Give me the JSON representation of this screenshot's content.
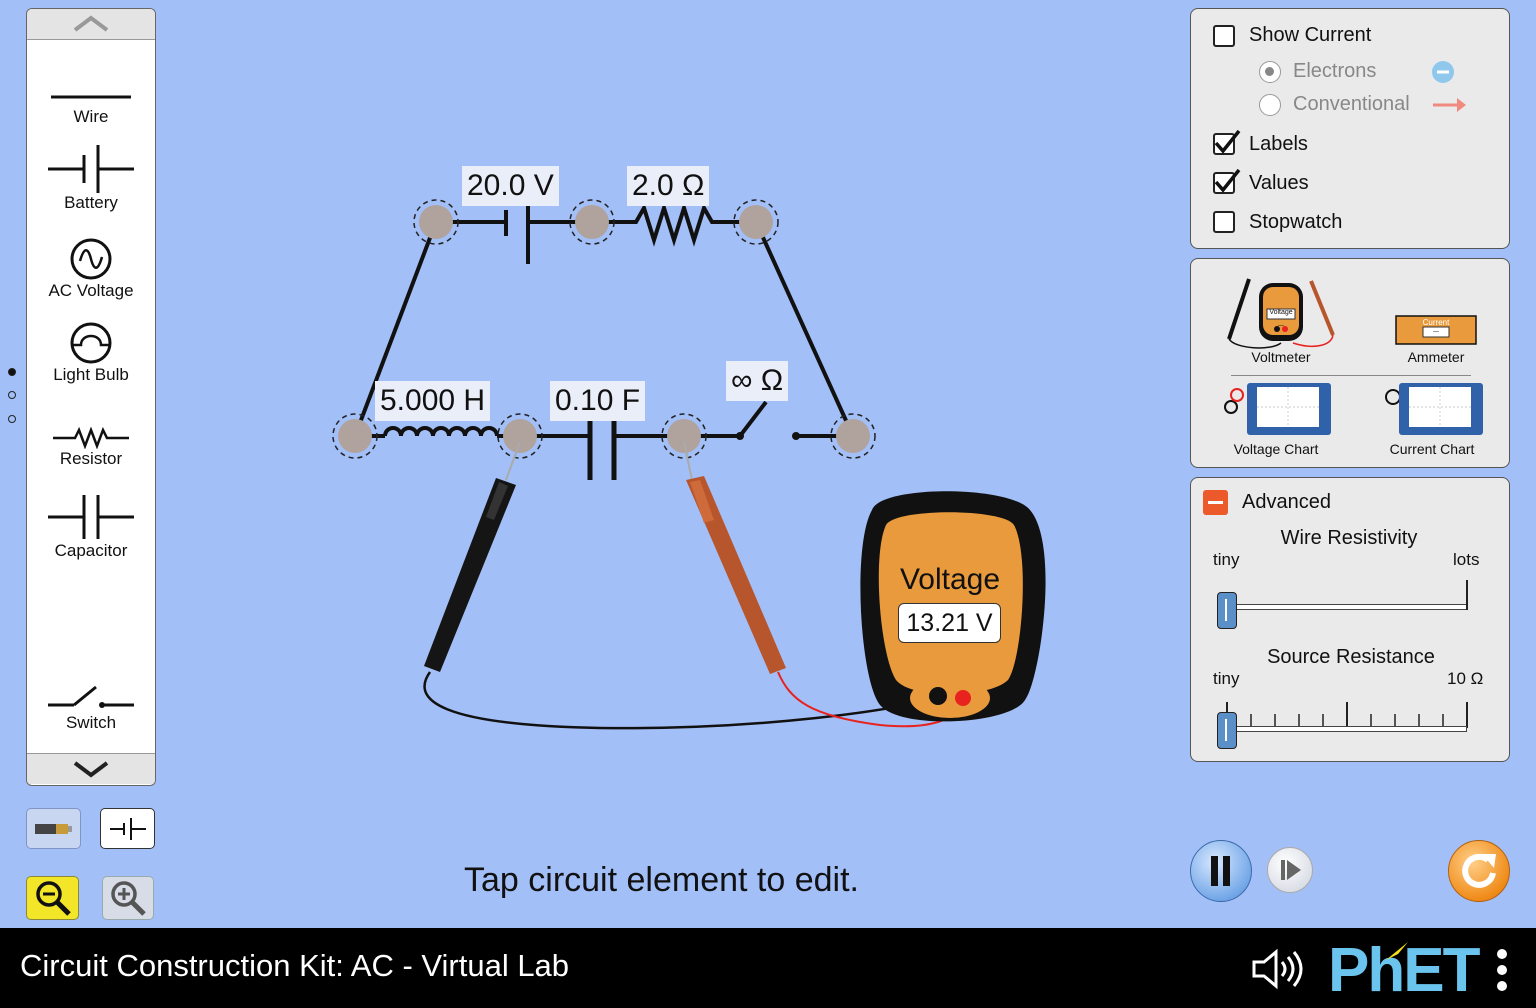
{
  "toolbox": {
    "items": [
      {
        "label": "Wire"
      },
      {
        "label": "Battery"
      },
      {
        "label": "AC Voltage"
      },
      {
        "label": "Light Bulb"
      },
      {
        "label": "Resistor"
      },
      {
        "label": "Capacitor"
      },
      {
        "label": "Switch"
      }
    ]
  },
  "display_options": {
    "show_current": {
      "label": "Show Current",
      "checked": false
    },
    "electrons": {
      "label": "Electrons",
      "selected": true
    },
    "conventional": {
      "label": "Conventional",
      "selected": false
    },
    "labels": {
      "label": "Labels",
      "checked": true
    },
    "values": {
      "label": "Values",
      "checked": true
    },
    "stopwatch": {
      "label": "Stopwatch",
      "checked": false
    }
  },
  "sensors": {
    "voltmeter": "Voltmeter",
    "ammeter": "Ammeter",
    "voltage_chart": "Voltage Chart",
    "current_chart": "Current Chart",
    "voltmeter_icon_text": "Voltage",
    "ammeter_icon_text": "Current",
    "icon_dash": "—"
  },
  "advanced": {
    "title": "Advanced",
    "wire_resistivity": {
      "title": "Wire Resistivity",
      "min": "tiny",
      "max": "lots",
      "value": 0
    },
    "source_resistance": {
      "title": "Source Resistance",
      "min": "tiny",
      "max": "10 Ω",
      "value": 0
    }
  },
  "circuit": {
    "battery_value": "20.0 V",
    "resistor_value": "2.0 Ω",
    "inductor_value": "5.000 H",
    "capacitor_value": "0.10 F",
    "switch_value": "∞ Ω"
  },
  "voltmeter_probe": {
    "title": "Voltage",
    "reading": "13.21 V"
  },
  "hint": "Tap circuit element to edit.",
  "footer": {
    "title": "Circuit Construction Kit: AC - Virtual Lab",
    "brand": "PhET"
  },
  "colors": {
    "background": "#a3bff7",
    "meter_orange": "#e89a3c",
    "reset_orange": "#f08c1a",
    "phet_blue": "#6ac4ee",
    "phet_yellow": "#f5e014"
  }
}
